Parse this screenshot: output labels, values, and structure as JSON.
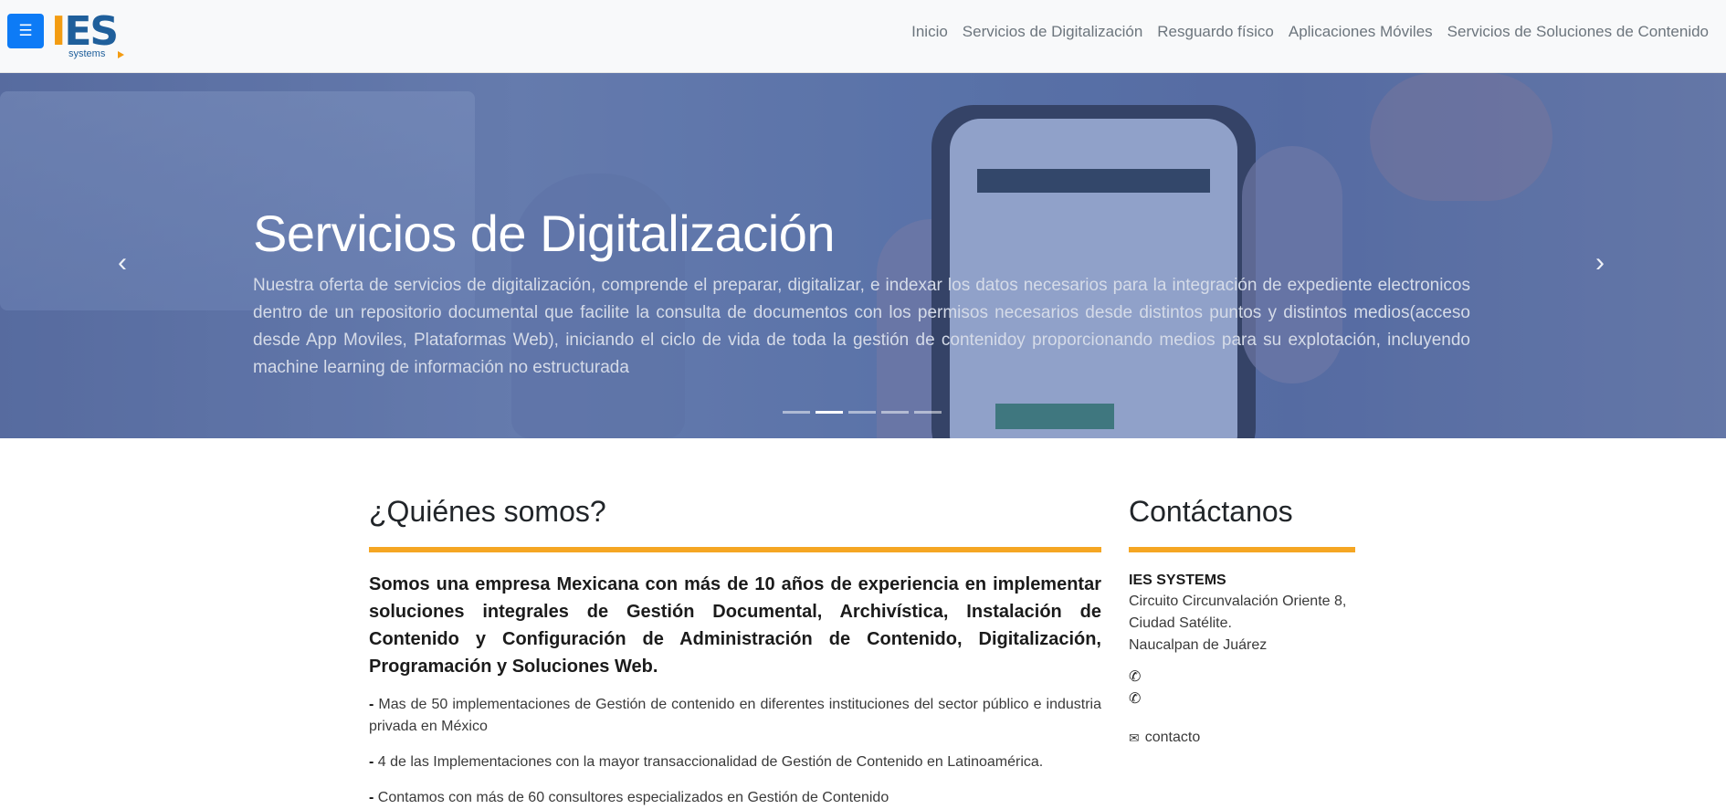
{
  "navbar": {
    "menu_icon": "☰",
    "logo": {
      "mark_i": "I",
      "mark_es": "ES",
      "sub": "systems"
    },
    "links": [
      "Inicio",
      "Servicios de Digitalización",
      "Resguardo físico",
      "Aplicaciones Móviles",
      "Servicios de Soluciones de Contenido"
    ]
  },
  "hero": {
    "title": "Servicios de Digitalización",
    "text": "Nuestra oferta de servicios de digitalización, comprende el preparar, digitalizar, e indexar los datos necesarios para la integración de expediente electronicos dentro de un repositorio documental que facilite la consulta de documentos con los permisos necesarios desde distintos puntos y distintos medios(acceso desde App Moviles, Plataformas Web), iniciando el ciclo de vida de toda la gestión de contenidoy proporcionando medios para su explotación, incluyendo machine learning de información no estructurada",
    "prev_icon": "‹",
    "next_icon": "›",
    "slide_count": 5,
    "active_slide": 2
  },
  "about": {
    "title": "¿Quiénes somos?",
    "lead": "Somos una empresa Mexicana con más de 10 años de experiencia en implementar soluciones integrales de Gestión Documental, Archivística, Instalación de Contenido y Configuración de Administración de Contenido, Digitalización, Programación y Soluciones Web.",
    "items": [
      "Mas de 50 implementaciones de Gestión de contenido en diferentes instituciones del sector público e industria privada en México",
      "4 de las Implementaciones con la mayor transaccionalidad de Gestión de Contenido en Latinoamérica.",
      "Contamos con más de 60 consultores especializados en Gestión de Contenido"
    ],
    "bullet": "-"
  },
  "contact": {
    "title": "Contáctanos",
    "name": "IES SYSTEMS",
    "address": [
      "Circuito Circunvalación Oriente 8,",
      "Ciudad Satélite.",
      "Naucalpan de Juárez"
    ],
    "phone_icon": "✆",
    "email_icon": "✉",
    "email": "contacto"
  },
  "colors": {
    "accent": "#f5a623",
    "primary": "#0d7bf6",
    "logo_blue": "#1f5f9b",
    "logo_orange": "#f39c12"
  }
}
